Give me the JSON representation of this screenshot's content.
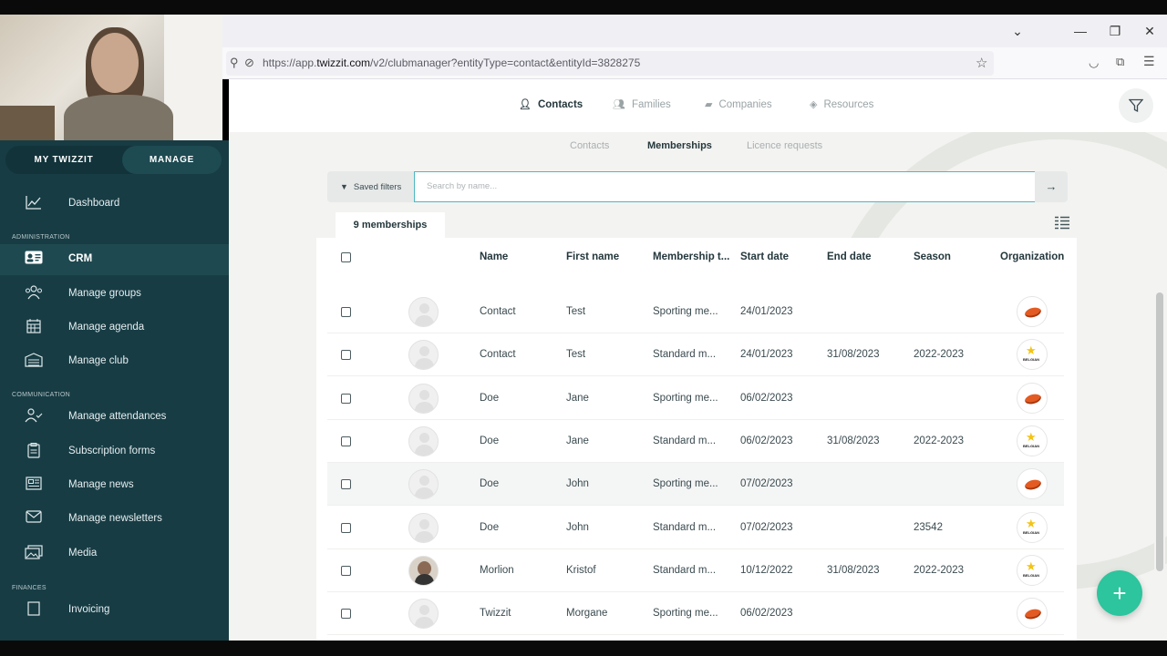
{
  "browser": {
    "url_prefix": "https://app.",
    "url_domain": "twizzit.com",
    "url_rest": "/v2/clubmanager?entityType=contact&entityId=3828275"
  },
  "sidebar": {
    "switch": {
      "my": "MY TWIZZIT",
      "manage": "MANAGE"
    },
    "sections": {
      "administration": "ADMINISTRATION",
      "communication": "COMMUNICATION",
      "finances": "FINANCES"
    },
    "items": [
      {
        "label": "Dashboard",
        "icon": "chart-line-icon"
      },
      {
        "label": "CRM",
        "icon": "contact-card-icon"
      },
      {
        "label": "Manage groups",
        "icon": "users-group-icon"
      },
      {
        "label": "Manage agenda",
        "icon": "calendar-icon"
      },
      {
        "label": "Manage club",
        "icon": "building-icon"
      },
      {
        "label": "Manage attendances",
        "icon": "user-check-icon"
      },
      {
        "label": "Subscription forms",
        "icon": "clipboard-icon"
      },
      {
        "label": "Manage news",
        "icon": "newspaper-icon"
      },
      {
        "label": "Manage newsletters",
        "icon": "envelope-icon"
      },
      {
        "label": "Media",
        "icon": "images-icon"
      },
      {
        "label": "Invoicing",
        "icon": "invoice-icon"
      }
    ]
  },
  "topnav": {
    "contacts": "Contacts",
    "families": "Families",
    "companies": "Companies",
    "resources": "Resources"
  },
  "subtabs": {
    "contacts": "Contacts",
    "memberships": "Memberships",
    "licence": "Licence requests"
  },
  "filters": {
    "saved": "Saved filters",
    "search_placeholder": "Search by name..."
  },
  "count_label": "9 memberships",
  "table": {
    "headers": {
      "name": "Name",
      "first_name": "First name",
      "membership": "Membership t...",
      "start": "Start date",
      "end": "End date",
      "season": "Season",
      "org": "Organization"
    },
    "rows": [
      {
        "name": "Contact",
        "first": "Test",
        "membership": "Sporting me...",
        "start": "24/01/2023",
        "end": "",
        "season": "",
        "org": "disc"
      },
      {
        "name": "Contact",
        "first": "Test",
        "membership": "Standard m...",
        "start": "24/01/2023",
        "end": "31/08/2023",
        "season": "2022-2023",
        "org": "belgian"
      },
      {
        "name": "Doe",
        "first": "Jane",
        "membership": "Sporting me...",
        "start": "06/02/2023",
        "end": "",
        "season": "",
        "org": "disc"
      },
      {
        "name": "Doe",
        "first": "Jane",
        "membership": "Standard m...",
        "start": "06/02/2023",
        "end": "31/08/2023",
        "season": "2022-2023",
        "org": "belgian"
      },
      {
        "name": "Doe",
        "first": "John",
        "membership": "Sporting me...",
        "start": "07/02/2023",
        "end": "",
        "season": "",
        "org": "disc"
      },
      {
        "name": "Doe",
        "first": "John",
        "membership": "Standard m...",
        "start": "07/02/2023",
        "end": "",
        "season": "23542",
        "org": "belgian"
      },
      {
        "name": "Morlion",
        "first": "Kristof",
        "membership": "Standard m...",
        "start": "10/12/2022",
        "end": "31/08/2023",
        "season": "2022-2023",
        "org": "belgian"
      },
      {
        "name": "Twizzit",
        "first": "Morgane",
        "membership": "Sporting me...",
        "start": "06/02/2023",
        "end": "",
        "season": "",
        "org": "disc"
      }
    ]
  },
  "org_logo_text": "BELGIAN"
}
